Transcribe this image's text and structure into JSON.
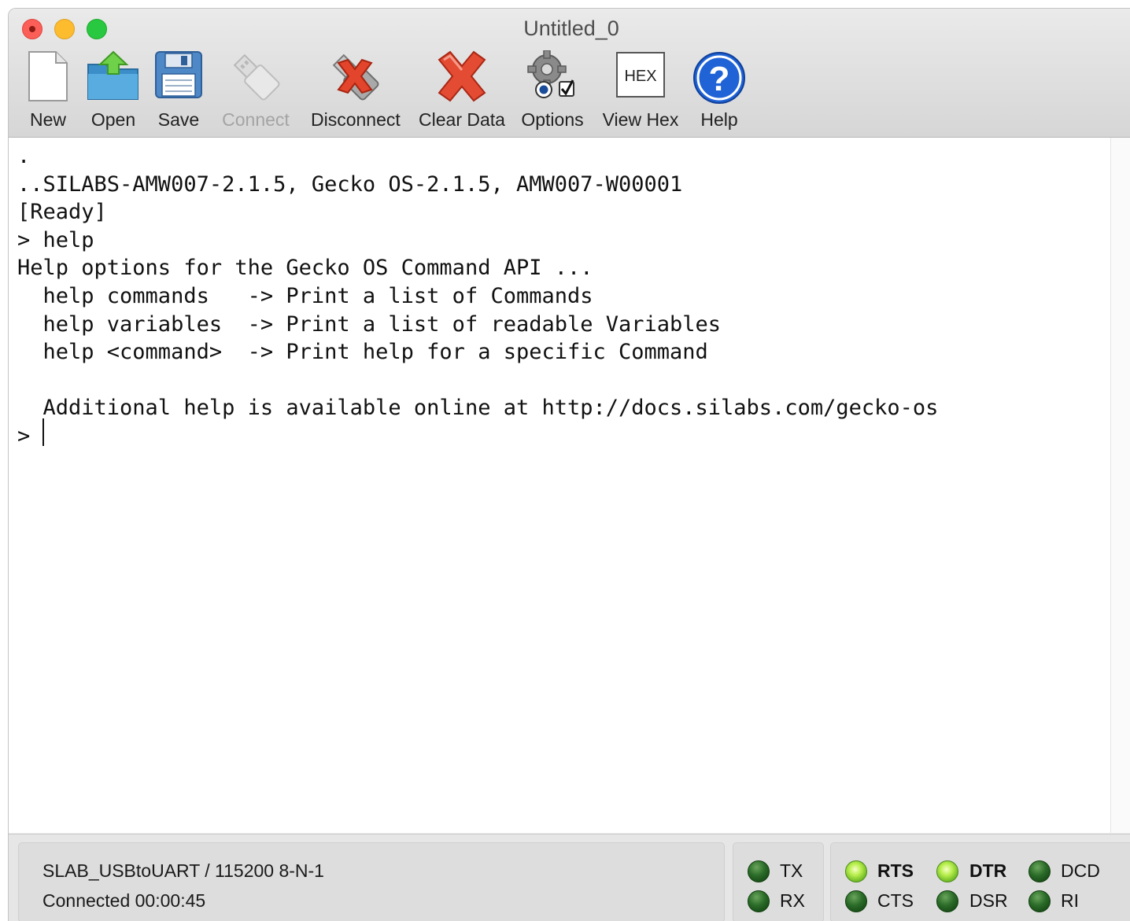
{
  "window": {
    "title": "Untitled_0"
  },
  "toolbar": {
    "new_label": "New",
    "open_label": "Open",
    "save_label": "Save",
    "connect_label": "Connect",
    "disconnect_label": "Disconnect",
    "clear_label": "Clear Data",
    "options_label": "Options",
    "viewhex_label": "View Hex",
    "viewhex_icon_text": "HEX",
    "help_label": "Help",
    "help_icon_text": "?"
  },
  "terminal": {
    "lines": [
      ".",
      "..SILABS-AMW007-2.1.5, Gecko OS-2.1.5, AMW007-W00001",
      "[Ready]",
      "> help",
      "Help options for the Gecko OS Command API ...",
      "  help commands   -> Print a list of Commands",
      "  help variables  -> Print a list of readable Variables",
      "  help <command>  -> Print help for a specific Command",
      "",
      "  Additional help is available online at http://docs.silabs.com/gecko-os",
      "> "
    ]
  },
  "status": {
    "port": "SLAB_USBtoUART / 115200 8-N-1",
    "connection": "Connected 00:00:45",
    "tx_label": "TX",
    "rx_label": "RX",
    "rts_label": "RTS",
    "cts_label": "CTS",
    "dtr_label": "DTR",
    "dsr_label": "DSR",
    "dcd_label": "DCD",
    "ri_label": "RI",
    "leds": {
      "tx": "off",
      "rx": "off",
      "rts": "on",
      "cts": "off",
      "dtr": "on",
      "dsr": "off",
      "dcd": "off",
      "ri": "off"
    }
  },
  "colors": {
    "led_on": "#b9ef4e",
    "led_off": "#2a6b28",
    "disconnect_red": "#e2452c",
    "help_blue": "#1f63d6"
  }
}
